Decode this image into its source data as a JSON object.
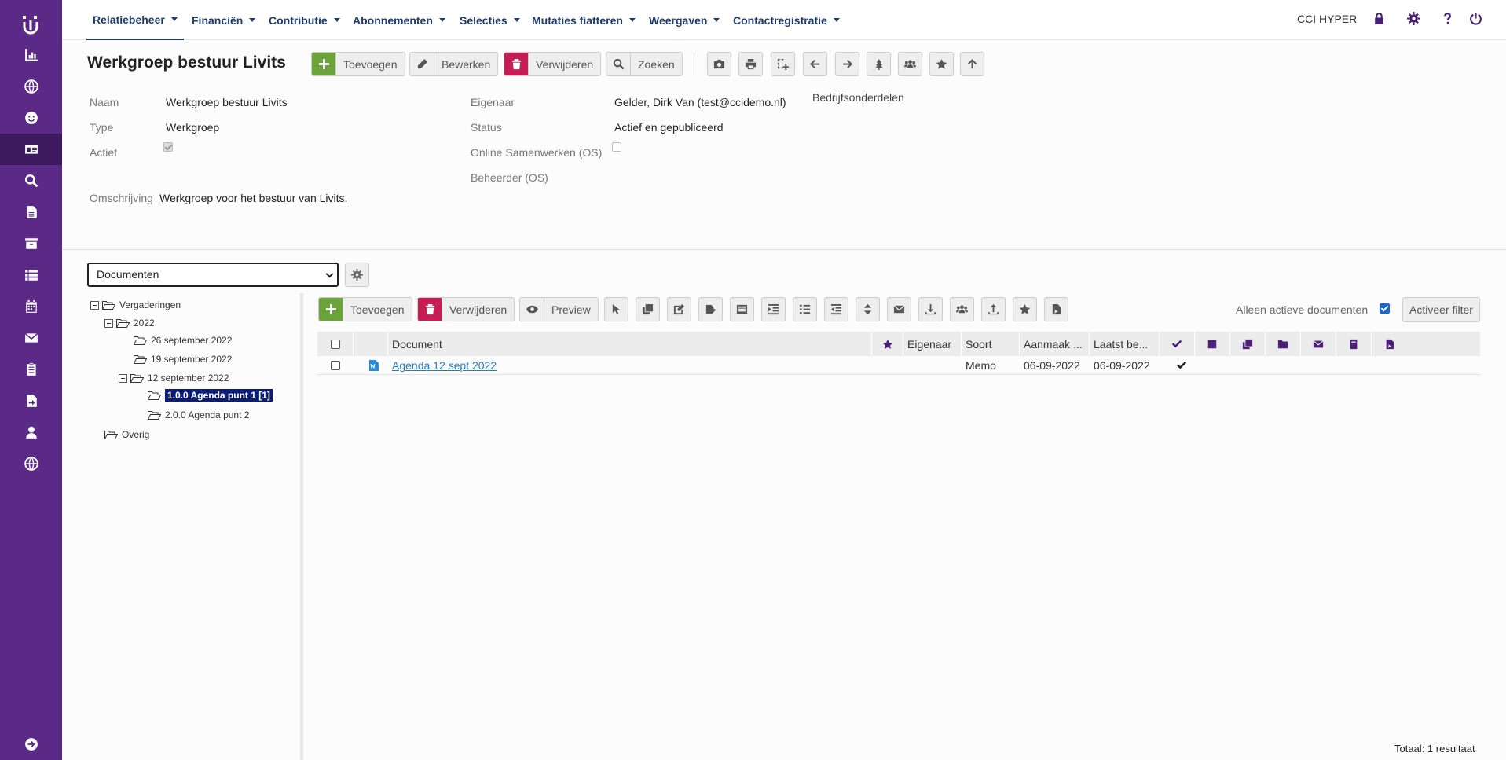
{
  "nav": {
    "items": [
      "Relatiebeheer",
      "Financiën",
      "Contributie",
      "Abonnementen",
      "Selecties",
      "Mutaties fiatteren",
      "Weergaven",
      "Contactregistratie"
    ],
    "org": "CCI HYPER"
  },
  "sidebar": {
    "icons": [
      "chart-icon",
      "globe-icon",
      "smiley-icon",
      "id-card-icon",
      "search-icon",
      "document-icon",
      "archive-icon",
      "list-icon",
      "calendar-icon",
      "mail-icon",
      "clipboard-icon",
      "file-export-icon",
      "user-icon",
      "globe-icon",
      "logout-icon"
    ]
  },
  "header": {
    "title": "Werkgroep bestuur Livits",
    "add": "Toevoegen",
    "edit": "Bewerken",
    "delete": "Verwijderen",
    "search": "Zoeken"
  },
  "details": {
    "naam_label": "Naam",
    "naam": "Werkgroep bestuur Livits",
    "type_label": "Type",
    "type": "Werkgroep",
    "actief_label": "Actief",
    "actief": true,
    "omschrijving_label": "Omschrijving",
    "omschrijving": "Werkgroep voor het bestuur van Livits.",
    "eigenaar_label": "Eigenaar",
    "eigenaar": "Gelder, Dirk Van (test@ccidemo.nl)",
    "status_label": "Status",
    "status": "Actief en gepubliceerd",
    "online_label": "Online Samenwerken (OS)",
    "online": false,
    "beheerder_label": "Beheerder (OS)",
    "bedrijf_label": "Bedrijfsonderdelen"
  },
  "docs": {
    "select_value": "Documenten",
    "add": "Toevoegen",
    "delete": "Verwijderen",
    "preview": "Preview",
    "active_only_label": "Alleen actieve documenten",
    "active_only": true,
    "filter_button": "Activeer filter",
    "total": "Totaal: 1 resultaat"
  },
  "tree": [
    {
      "label": "Vergaderingen",
      "level": 0,
      "toggle": true
    },
    {
      "label": "2022",
      "level": 1,
      "toggle": true
    },
    {
      "label": "26 september 2022",
      "level": 2,
      "toggle": false
    },
    {
      "label": "19 september 2022",
      "level": 2,
      "toggle": false
    },
    {
      "label": "12 september 2022",
      "level": 2,
      "toggle": true
    },
    {
      "label": "1.0.0 Agenda punt 1 [1]",
      "level": 3,
      "toggle": false,
      "selected": true
    },
    {
      "label": "2.0.0 Agenda punt 2",
      "level": 3,
      "toggle": false
    },
    {
      "label": "Overig",
      "level": 1,
      "toggle": false
    }
  ],
  "table": {
    "columns": {
      "document": "Document",
      "eigenaar": "Eigenaar",
      "soort": "Soort",
      "aanmaak": "Aanmaak ...",
      "laatst": "Laatst be..."
    },
    "rows": [
      {
        "document": "Agenda 12 sept 2022",
        "eigenaar": "",
        "soort": "Memo",
        "aanmaak": "06-09-2022",
        "laatst": "06-09-2022",
        "done": true
      }
    ]
  }
}
